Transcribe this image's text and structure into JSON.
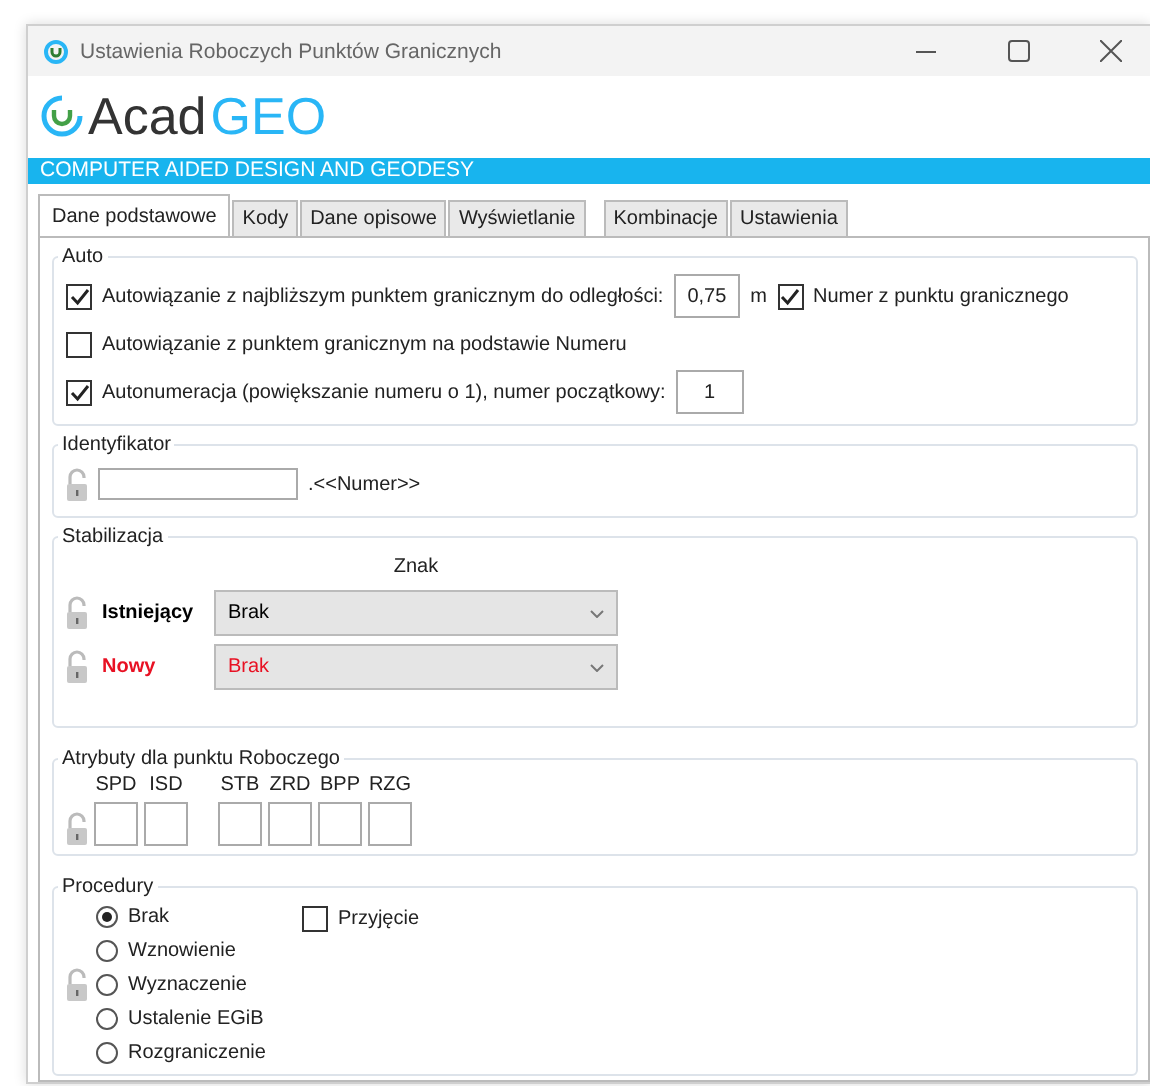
{
  "window": {
    "title": "Ustawienia Roboczych Punktów Granicznych"
  },
  "logo": {
    "part_1": "Acad",
    "part_2": "GEO",
    "tagline": "COMPUTER AIDED DESIGN AND GEODESY"
  },
  "tabs": [
    {
      "label": "Dane podstawowe",
      "selected": true
    },
    {
      "label": "Kody",
      "selected": false
    },
    {
      "label": "Dane opisowe",
      "selected": false
    },
    {
      "label": "Wyświetlanie",
      "selected": false
    },
    {
      "label": "Kombinacje",
      "selected": false
    },
    {
      "label": "Ustawienia",
      "selected": false
    }
  ],
  "auto": {
    "title": "Auto",
    "snap_distance": {
      "label": "Autowiązanie z najbliższym punktem granicznym do odległości:",
      "checked": true,
      "value": "0,75",
      "unit": "m"
    },
    "number_from_point": {
      "label": "Numer z punktu granicznego",
      "checked": true
    },
    "snap_by_number": {
      "label": "Autowiązanie z punktem granicznym na podstawie Numeru",
      "checked": false
    },
    "autonumbering": {
      "label": "Autonumeracja (powiększanie numeru o 1), numer początkowy:",
      "checked": true,
      "value": "1"
    }
  },
  "identifier": {
    "title": "Identyfikator",
    "suffix": ".<<Numer>>"
  },
  "stabilization": {
    "title": "Stabilizacja",
    "column": "Znak",
    "rows": [
      {
        "label": "Istniejący",
        "value": "Brak",
        "color": "#000000"
      },
      {
        "label": "Nowy",
        "value": "Brak",
        "color": "#e81123"
      }
    ]
  },
  "attributes": {
    "title": "Atrybuty dla punktu Roboczego",
    "fields": [
      {
        "label": "SPD"
      },
      {
        "label": "ISD"
      },
      {
        "label": "STB"
      },
      {
        "label": "ZRD"
      },
      {
        "label": "BPP"
      },
      {
        "label": "RZG"
      }
    ]
  },
  "procedures": {
    "title": "Procedury",
    "options": [
      {
        "label": "Brak",
        "selected": true
      },
      {
        "label": "Wznowienie",
        "selected": false
      },
      {
        "label": "Wyznaczenie",
        "selected": false
      },
      {
        "label": "Ustalenie EGiB",
        "selected": false
      },
      {
        "label": "Rozgraniczenie",
        "selected": false
      }
    ],
    "acceptance": {
      "label": "Przyjęcie",
      "checked": false
    }
  }
}
